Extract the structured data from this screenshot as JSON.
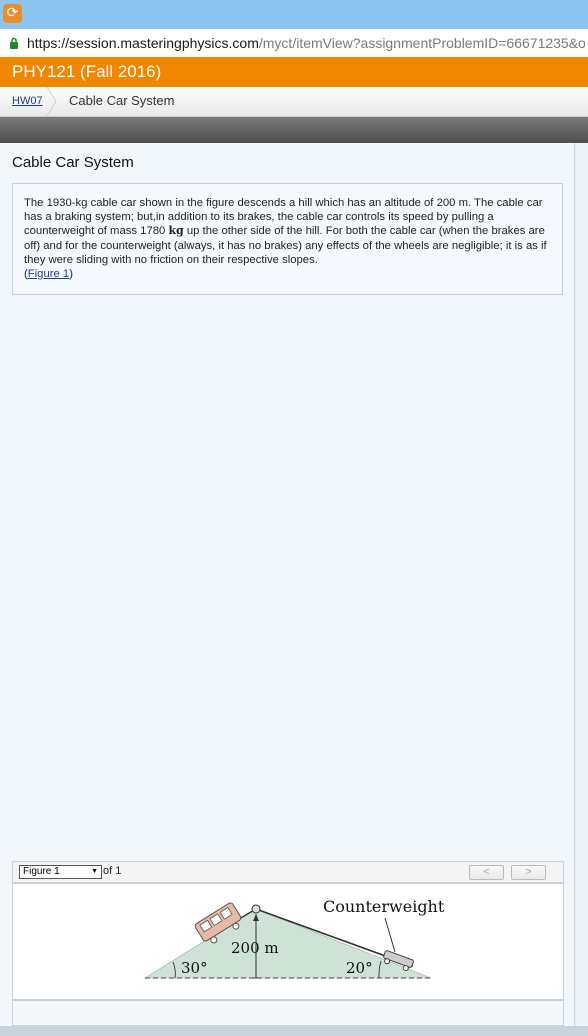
{
  "browser": {
    "icon_glyph": "⟳",
    "url_host": "https://session.masteringphysics.com",
    "url_rest": "/myct/itemView?assignmentProblemID=66671235&o"
  },
  "course": {
    "title": "PHY121 (Fall 2016)"
  },
  "breadcrumb": {
    "link": "HW07",
    "current": "Cable Car System"
  },
  "problem": {
    "title": "Cable Car System",
    "text_before_mass": "The 1930-kg cable car shown in the figure descends a hill which has an altitude of 200 m. The cable car has a braking system; but,in addition to its brakes, the cable car controls its speed by pulling a counterweight of mass 1780 ",
    "mass_unit": "kg",
    "text_after_mass": " up the other side of the hill. For both the cable car (when the brakes are off) and for the counterweight (always, it has no brakes) any effects of the wheels are negligible; it is as if they were sliding with no friction on their respective slopes.",
    "figure_link_open": "(",
    "figure_link": "Figure 1",
    "figure_link_close": ")"
  },
  "figure_viewer": {
    "selected": "Figure 1",
    "of_text": "of 1",
    "prev_label": "<",
    "next_label": ">"
  },
  "figure": {
    "counterweight_label": "Counterweight",
    "altitude_label": "200 m",
    "left_angle_label": "30°",
    "right_angle_label": "20°"
  }
}
